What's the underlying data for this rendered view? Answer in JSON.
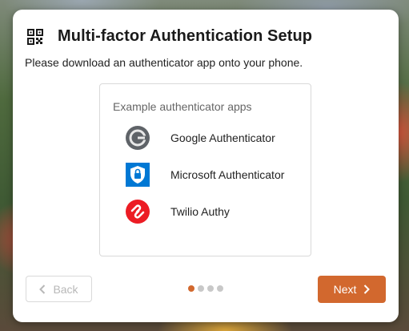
{
  "dialog": {
    "title": "Multi-factor Authentication Setup",
    "title_icon": "qr-code-icon",
    "instruction": "Please download an authenticator app onto your phone."
  },
  "apps": {
    "heading": "Example authenticator apps",
    "items": [
      {
        "label": "Google Authenticator",
        "icon": "google-authenticator-icon",
        "color": "#5f6368"
      },
      {
        "label": "Microsoft Authenticator",
        "icon": "microsoft-authenticator-icon",
        "color": "#0078d4"
      },
      {
        "label": "Twilio Authy",
        "icon": "twilio-authy-icon",
        "color": "#ec1c24"
      }
    ]
  },
  "footer": {
    "back_label": "Back",
    "next_label": "Next",
    "step_current": 1,
    "step_total": 4
  },
  "colors": {
    "accent": "#d2682e",
    "disabled_text": "#b8b8b8",
    "inactive_dot": "#c8c8c8"
  }
}
